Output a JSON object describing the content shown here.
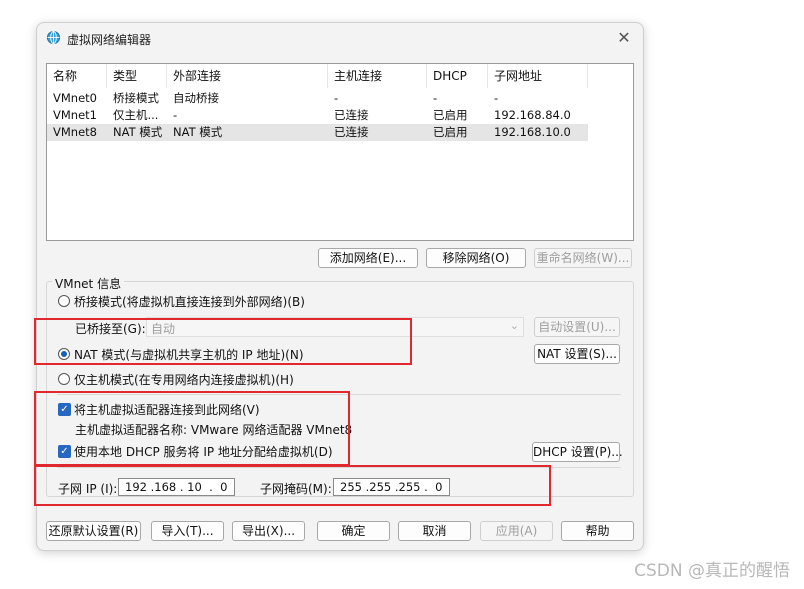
{
  "window": {
    "title": "虚拟网络编辑器",
    "close_glyph": "✕"
  },
  "table": {
    "columns": [
      "名称",
      "类型",
      "外部连接",
      "主机连接",
      "DHCP",
      "子网地址"
    ],
    "rows": [
      [
        "VMnet0",
        "桥接模式",
        "自动桥接",
        "-",
        "-",
        "-"
      ],
      [
        "VMnet1",
        "仅主机...",
        "-",
        "已连接",
        "已启用",
        "192.168.84.0"
      ],
      [
        "VMnet8",
        "NAT 模式",
        "NAT 模式",
        "已连接",
        "已启用",
        "192.168.10.0"
      ]
    ],
    "selected_row": 2
  },
  "buttons_mid": {
    "add": "添加网络(E)...",
    "remove": "移除网络(O)",
    "rename": "重命名网络(W)..."
  },
  "vmnet_info": {
    "label": "VMnet 信息",
    "bridge_radio": "桥接模式(将虚拟机直接连接到外部网络)(B)",
    "bridge_to_label": "已桥接至(G):",
    "bridge_to_value": "自动",
    "auto_settings": "自动设置(U)...",
    "nat_radio": "NAT 模式(与虚拟机共享主机的 IP 地址)(N)",
    "nat_settings": "NAT 设置(S)...",
    "hostonly_radio": "仅主机模式(在专用网络内连接虚拟机)(H)",
    "connect_adapter": "将主机虚拟适配器连接到此网络(V)",
    "adapter_name": "主机虚拟适配器名称: VMware 网络适配器 VMnet8",
    "use_dhcp": "使用本地 DHCP 服务将 IP 地址分配给虚拟机(D)",
    "dhcp_settings": "DHCP 设置(P)...",
    "subnet_ip_label": "子网 IP (I):",
    "subnet_ip": "192 .168 . 10  .  0",
    "subnet_mask_label": "子网掩码(M):",
    "subnet_mask": "255 .255 .255 .  0"
  },
  "buttons_bottom": {
    "restore": "还原默认设置(R)",
    "import": "导入(T)...",
    "export": "导出(X)...",
    "ok": "确定",
    "cancel": "取消",
    "apply": "应用(A)",
    "help": "帮助"
  },
  "watermark": "CSDN @真正的醒悟",
  "colors": {
    "highlight_box": "#e0282e",
    "accent": "#2766c1"
  }
}
